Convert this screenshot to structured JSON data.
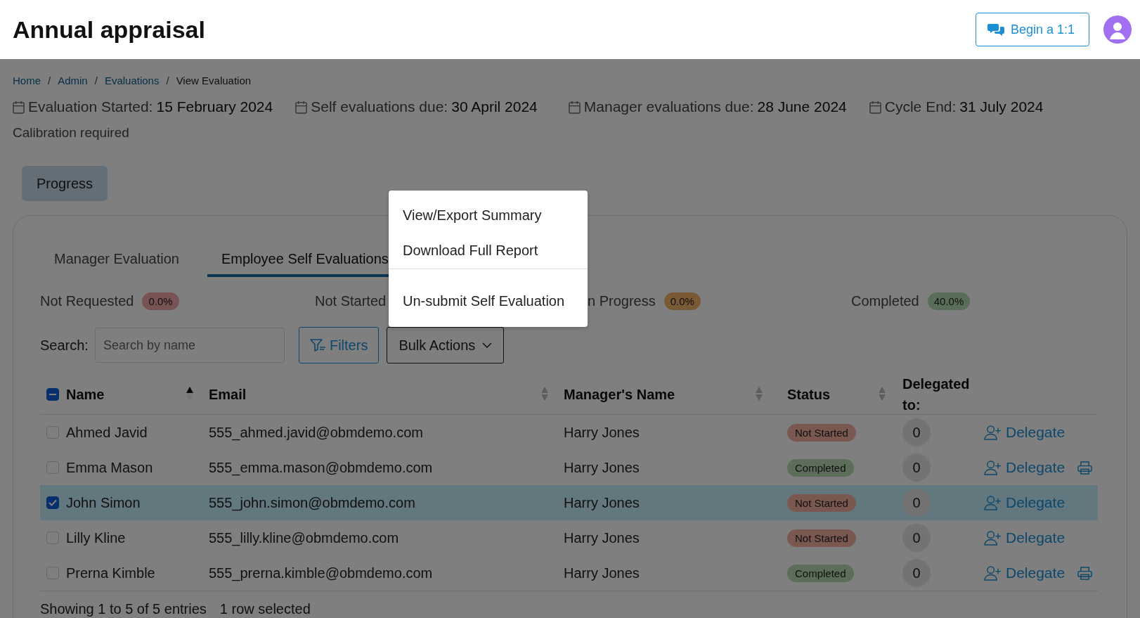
{
  "header": {
    "title": "Annual appraisal",
    "action_button": "Begin a 1:1"
  },
  "breadcrumb": [
    {
      "label": "Home",
      "link": true
    },
    {
      "separator_before": "/",
      "label": "Admin",
      "link": true
    },
    {
      "separator_before": "/",
      "label": "Evaluations",
      "link": true
    },
    {
      "separator_before": "/",
      "label": "View Evaluation",
      "link": false
    }
  ],
  "dates": [
    {
      "label": "Evaluation Started:",
      "value": "15 February 2024"
    },
    {
      "label": "Self evaluations due:",
      "value": "30 April 2024"
    },
    {
      "label": "Manager evaluations due:",
      "value": "28 June 2024"
    },
    {
      "label": "Cycle End:",
      "value": "31 July 2024"
    }
  ],
  "note": "Calibration required",
  "progress_button": "Progress",
  "tabs": [
    {
      "label": "Manager Evaluation",
      "selected": false
    },
    {
      "label": "Employee Self Evaluations",
      "selected": true
    }
  ],
  "stats": [
    {
      "label": "Not Requested",
      "badge": "0.0%",
      "kind": "danger"
    },
    {
      "label": "Not Started"
    },
    {
      "label": "n Progress",
      "badge": "0.0%",
      "kind": "warning"
    },
    {
      "label": "Completed",
      "badge": "40.0%",
      "kind": "success"
    }
  ],
  "search": {
    "label": "Search:",
    "placeholder": "Search by name"
  },
  "filters_button": "Filters",
  "bulk_actions_button": "Bulk Actions",
  "bulk_menu": [
    {
      "label": "View/Export Summary",
      "divider_before": false
    },
    {
      "label": "Download Full Report",
      "divider_before": false
    },
    {
      "label": "Un-submit Self Evaluation",
      "divider_before": true
    }
  ],
  "table": {
    "select_all_indeterminate": true,
    "columns": [
      {
        "label": "Name",
        "sortable": true,
        "sorted": true
      },
      {
        "label": "Email",
        "sortable": true,
        "sorted": false
      },
      {
        "label": "Manager's Name",
        "sortable": true,
        "sorted": false
      },
      {
        "label": "Status",
        "sortable": true,
        "sorted": false
      },
      {
        "label": "Delegated to:"
      }
    ],
    "rows": [
      {
        "selected": false,
        "name": "Ahmed Javid",
        "email": "555_ahmed.javid@obmdemo.com",
        "manager": "Harry Jones",
        "status": {
          "label": "Not Started",
          "kind": "danger"
        },
        "delegated": "0",
        "action": "Delegate",
        "printable": false
      },
      {
        "selected": false,
        "name": "Emma Mason",
        "email": "555_emma.mason@obmdemo.com",
        "manager": "Harry Jones",
        "status": {
          "label": "Completed",
          "kind": "success"
        },
        "delegated": "0",
        "action": "Delegate",
        "printable": true
      },
      {
        "selected": true,
        "name": "John Simon",
        "email": "555_john.simon@obmdemo.com",
        "manager": "Harry Jones",
        "status": {
          "label": "Not Started",
          "kind": "danger"
        },
        "delegated": "0",
        "action": "Delegate",
        "printable": false
      },
      {
        "selected": false,
        "name": "Lilly Kline",
        "email": "555_lilly.kline@obmdemo.com",
        "manager": "Harry Jones",
        "status": {
          "label": "Not Started",
          "kind": "danger"
        },
        "delegated": "0",
        "action": "Delegate",
        "printable": false
      },
      {
        "selected": false,
        "name": "Prerna Kimble",
        "email": "555_prerna.kimble@obmdemo.com",
        "manager": "Harry Jones",
        "status": {
          "label": "Completed",
          "kind": "success"
        },
        "delegated": "0",
        "action": "Delegate",
        "printable": true
      }
    ]
  },
  "footer": {
    "entries": "Showing 1 to 5 of 5 entries",
    "selection": "1 row selected"
  }
}
